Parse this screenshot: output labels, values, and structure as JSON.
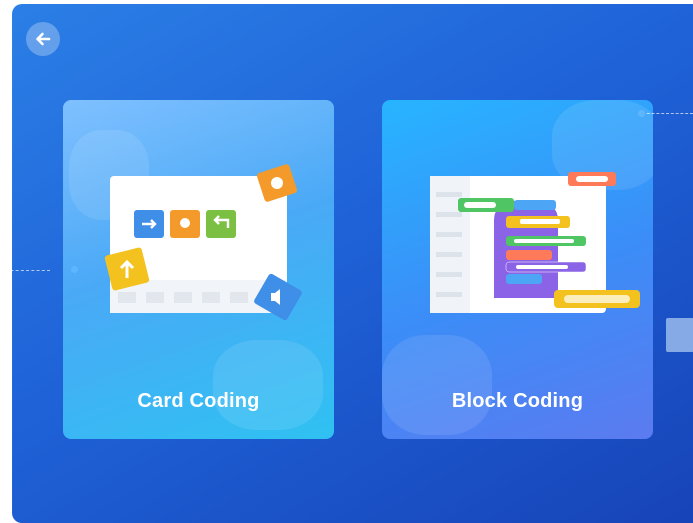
{
  "header": {
    "back_icon": "arrow-left-icon"
  },
  "modes": [
    {
      "label": "Card Coding",
      "icon": "card-puzzle-illustration"
    },
    {
      "label": "Block Coding",
      "icon": "block-code-illustration"
    }
  ],
  "colors": {
    "background_start": "#2b7fe6",
    "background_end": "#1744b8",
    "card_coding_bg": "#4aa9f6",
    "block_coding_bg": "#3c8cf7",
    "label_color": "#ffffff"
  }
}
